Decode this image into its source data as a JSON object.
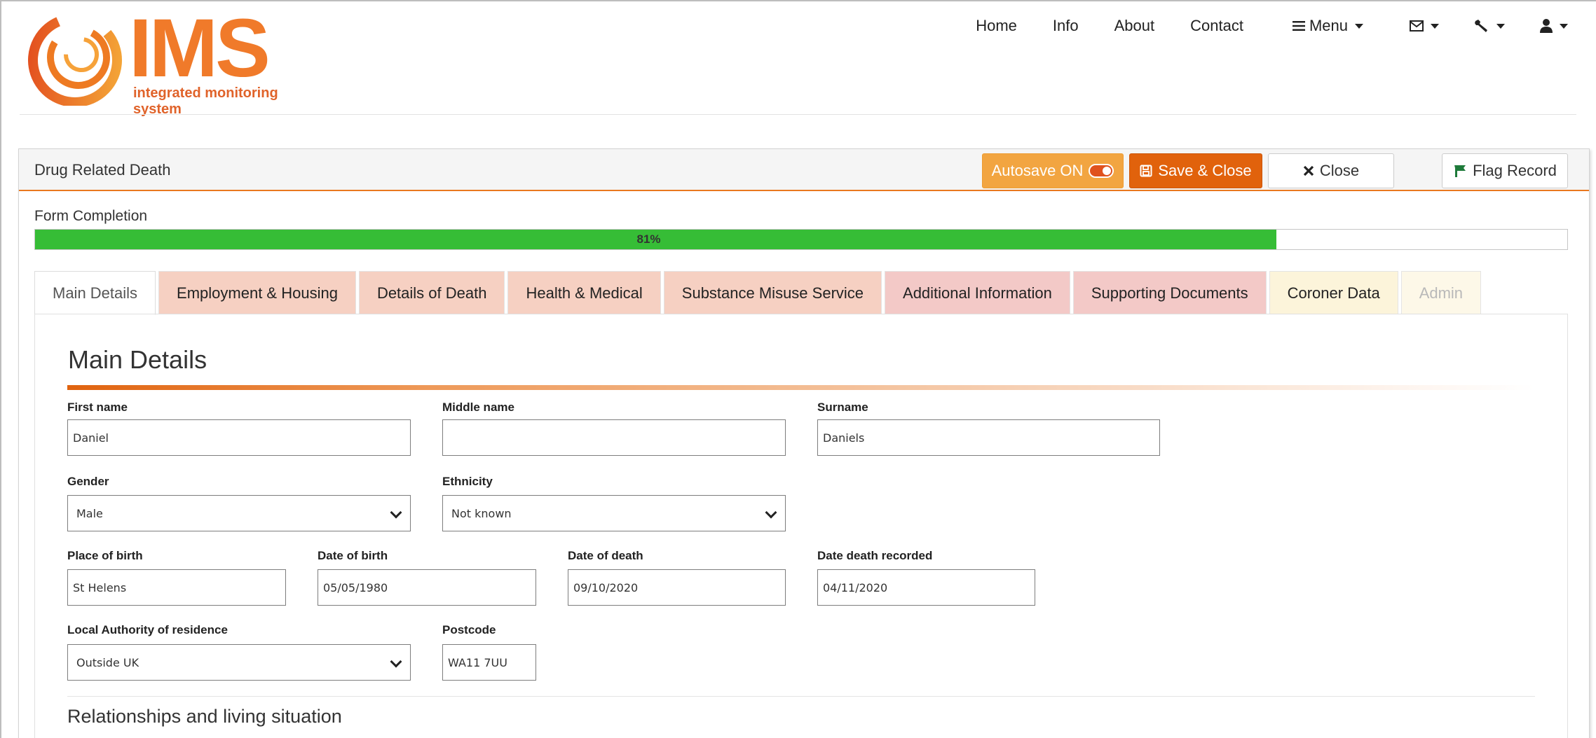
{
  "brand": {
    "name": "IMS",
    "tagline": "integrated monitoring system",
    "color": "#f07a2a"
  },
  "topnav": {
    "links": [
      "Home",
      "Info",
      "About",
      "Contact"
    ],
    "menu_label": "Menu",
    "icons": [
      "envelope-icon",
      "wrench-icon",
      "user-icon"
    ]
  },
  "panel": {
    "title": "Drug Related Death",
    "autosave_label": "Autosave ON",
    "save_close_label": "Save & Close",
    "close_label": "Close",
    "flag_label": "Flag Record"
  },
  "completion": {
    "label": "Form Completion",
    "percent": 81,
    "percent_text": "81%",
    "bar_color": "#36bd36"
  },
  "tabs": [
    {
      "label": "Main Details",
      "state": "active"
    },
    {
      "label": "Employment & Housing"
    },
    {
      "label": "Details of Death"
    },
    {
      "label": "Health & Medical"
    },
    {
      "label": "Substance Misuse Service"
    },
    {
      "label": "Additional Information"
    },
    {
      "label": "Supporting Documents"
    },
    {
      "label": "Coroner Data"
    },
    {
      "label": "Admin",
      "state": "disabled"
    }
  ],
  "main_details": {
    "heading": "Main Details",
    "first_name": {
      "label": "First name",
      "value": "Daniel"
    },
    "middle_name": {
      "label": "Middle name",
      "value": ""
    },
    "surname": {
      "label": "Surname",
      "value": "Daniels"
    },
    "gender": {
      "label": "Gender",
      "value": "Male"
    },
    "ethnicity": {
      "label": "Ethnicity",
      "value": "Not known"
    },
    "place_of_birth": {
      "label": "Place of birth",
      "value": "St Helens"
    },
    "date_of_birth": {
      "label": "Date of birth",
      "value": "05/05/1980"
    },
    "date_of_death": {
      "label": "Date of death",
      "value": "09/10/2020"
    },
    "date_death_recorded": {
      "label": "Date death recorded",
      "value": "04/11/2020"
    },
    "local_authority": {
      "label": "Local Authority of residence",
      "value": "Outside UK"
    },
    "postcode": {
      "label": "Postcode",
      "value": "WA11 7UU"
    }
  },
  "relationships": {
    "heading": "Relationships and living situation"
  }
}
